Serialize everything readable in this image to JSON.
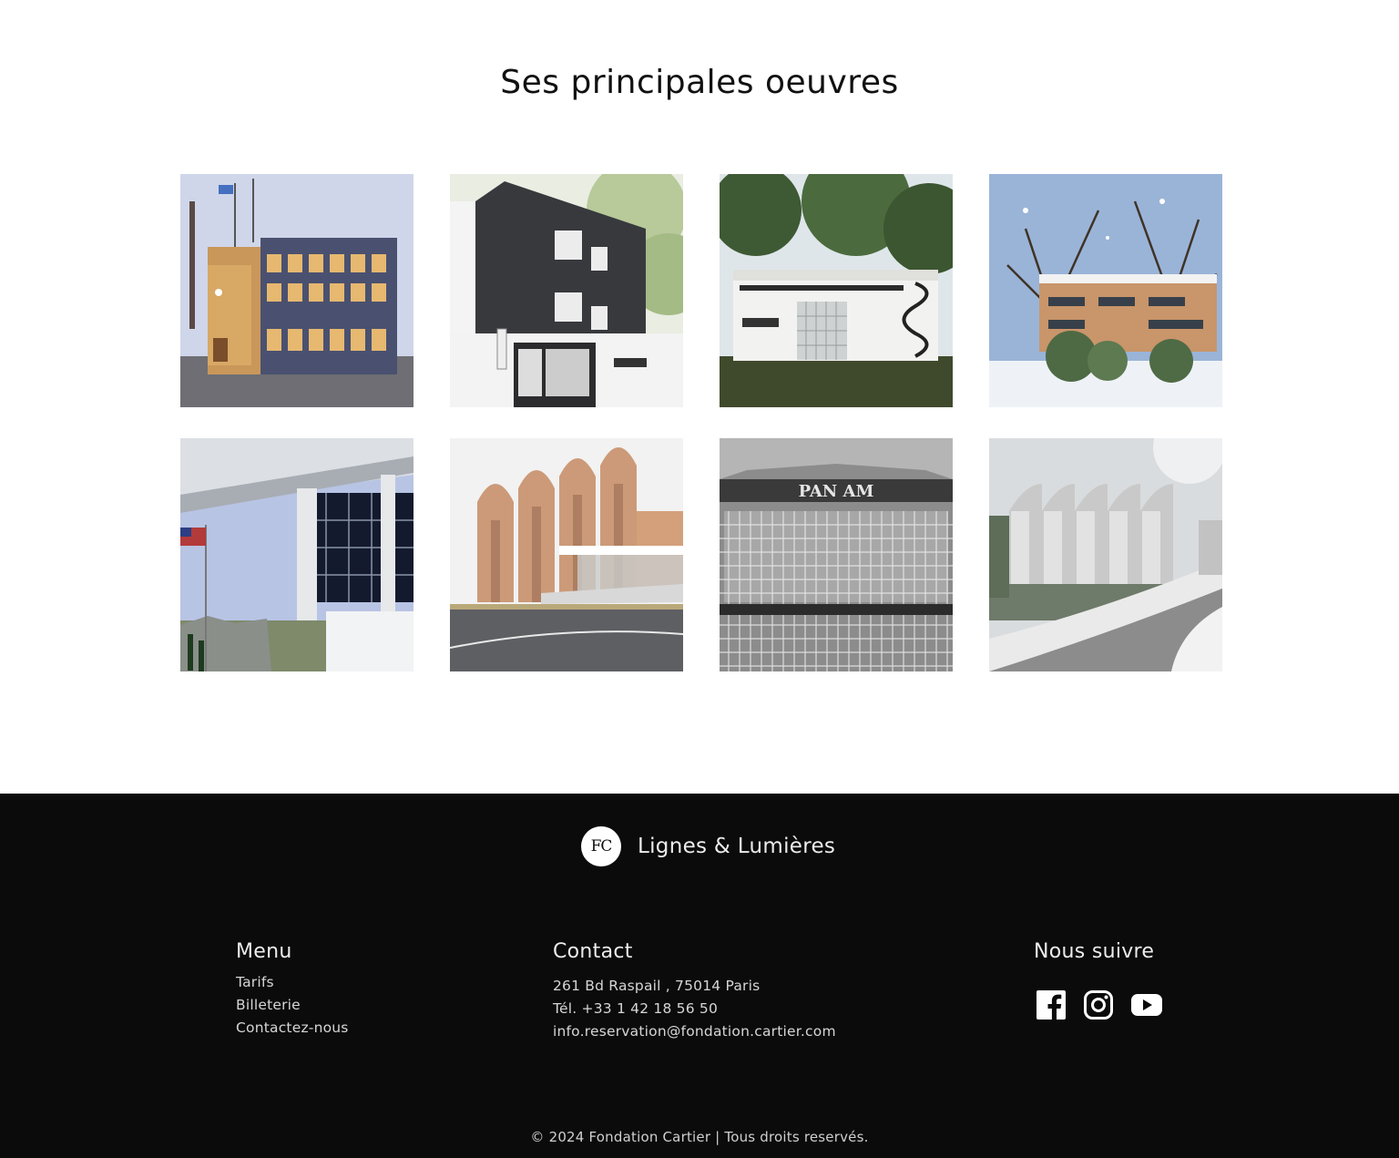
{
  "works_section": {
    "title": "Ses principales oeuvres",
    "gallery": [
      {
        "name": "factory-building-photo"
      },
      {
        "name": "dark-house-photo"
      },
      {
        "name": "white-villa-photo"
      },
      {
        "name": "snow-house-photo"
      },
      {
        "name": "glass-building-photo"
      },
      {
        "name": "temple-building-photo"
      },
      {
        "name": "panam-tower-photo"
      },
      {
        "name": "archive-building-photo"
      }
    ]
  },
  "footer": {
    "brand": {
      "logo_text": "FC",
      "name": "Lignes & Lumières"
    },
    "menu": {
      "title": "Menu",
      "items": [
        "Tarifs",
        "Billeterie",
        "Contactez-nous"
      ]
    },
    "contact": {
      "title": "Contact",
      "address": "261 Bd Raspail , 75014 Paris",
      "phone": "Tél. +33 1 42 18 56 50",
      "email": "info.reservation@fondation.cartier.com"
    },
    "follow": {
      "title": "Nous suivre",
      "icons": [
        "facebook-icon",
        "instagram-icon",
        "youtube-icon"
      ]
    },
    "copyright": "© 2024 Fondation Cartier | Tous droits reservés."
  }
}
